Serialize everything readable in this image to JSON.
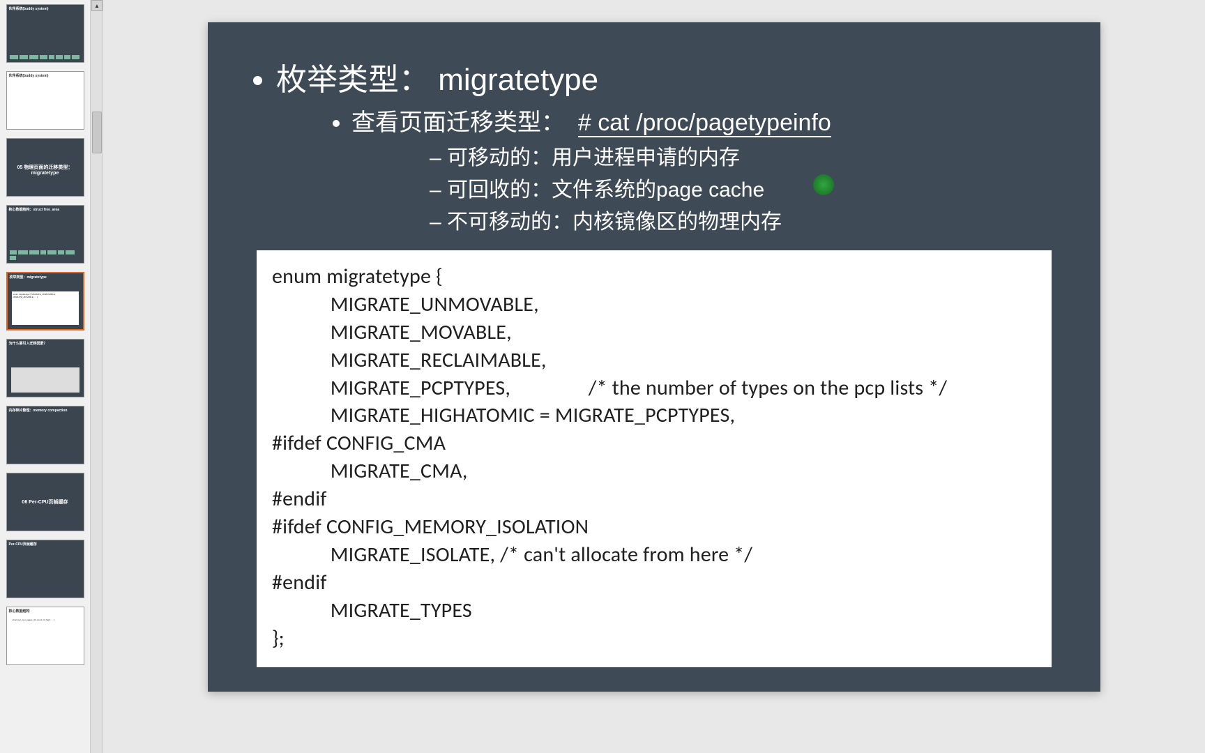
{
  "thumbnails": [
    {
      "label": "伙伴系统(buddy system)",
      "kind": "diagram"
    },
    {
      "label": "伙伴系统(buddy system)",
      "kind": "light-text"
    },
    {
      "label": "05 物理页面的迁移类型：migratetype",
      "kind": "title"
    },
    {
      "label": "核心数据结构：struct free_area",
      "kind": "diagram"
    },
    {
      "label": "枚举类型：migratetype",
      "kind": "code",
      "selected": true
    },
    {
      "label": "为什么要引入迁移因素？",
      "kind": "table"
    },
    {
      "label": "内存碎片整理：memory compaction",
      "kind": "text"
    },
    {
      "label": "06 Per-CPU页帧缓存",
      "kind": "title-center"
    },
    {
      "label": "Per-CPU页帧缓存",
      "kind": "text"
    },
    {
      "label": "核心数据结构",
      "kind": "light-code"
    }
  ],
  "slide": {
    "title": "枚举类型： migratetype",
    "sub_prefix": "查看页面迁移类型：",
    "sub_cmd": "# cat  /proc/pagetypeinfo",
    "points": [
      "可移动的：用户进程申请的内存",
      "可回收的：文件系统的page cache",
      "不可移动的：内核镜像区的物理内存"
    ],
    "code": "enum migratetype {\n            MIGRATE_UNMOVABLE,\n            MIGRATE_MOVABLE,\n            MIGRATE_RECLAIMABLE,\n            MIGRATE_PCPTYPES,                /* the number of types on the pcp lists */\n            MIGRATE_HIGHATOMIC = MIGRATE_PCPTYPES,\n#ifdef CONFIG_CMA\n            MIGRATE_CMA,\n#endif\n#ifdef CONFIG_MEMORY_ISOLATION\n            MIGRATE_ISOLATE, /* can't allocate from here */\n#endif\n            MIGRATE_TYPES\n};"
  }
}
